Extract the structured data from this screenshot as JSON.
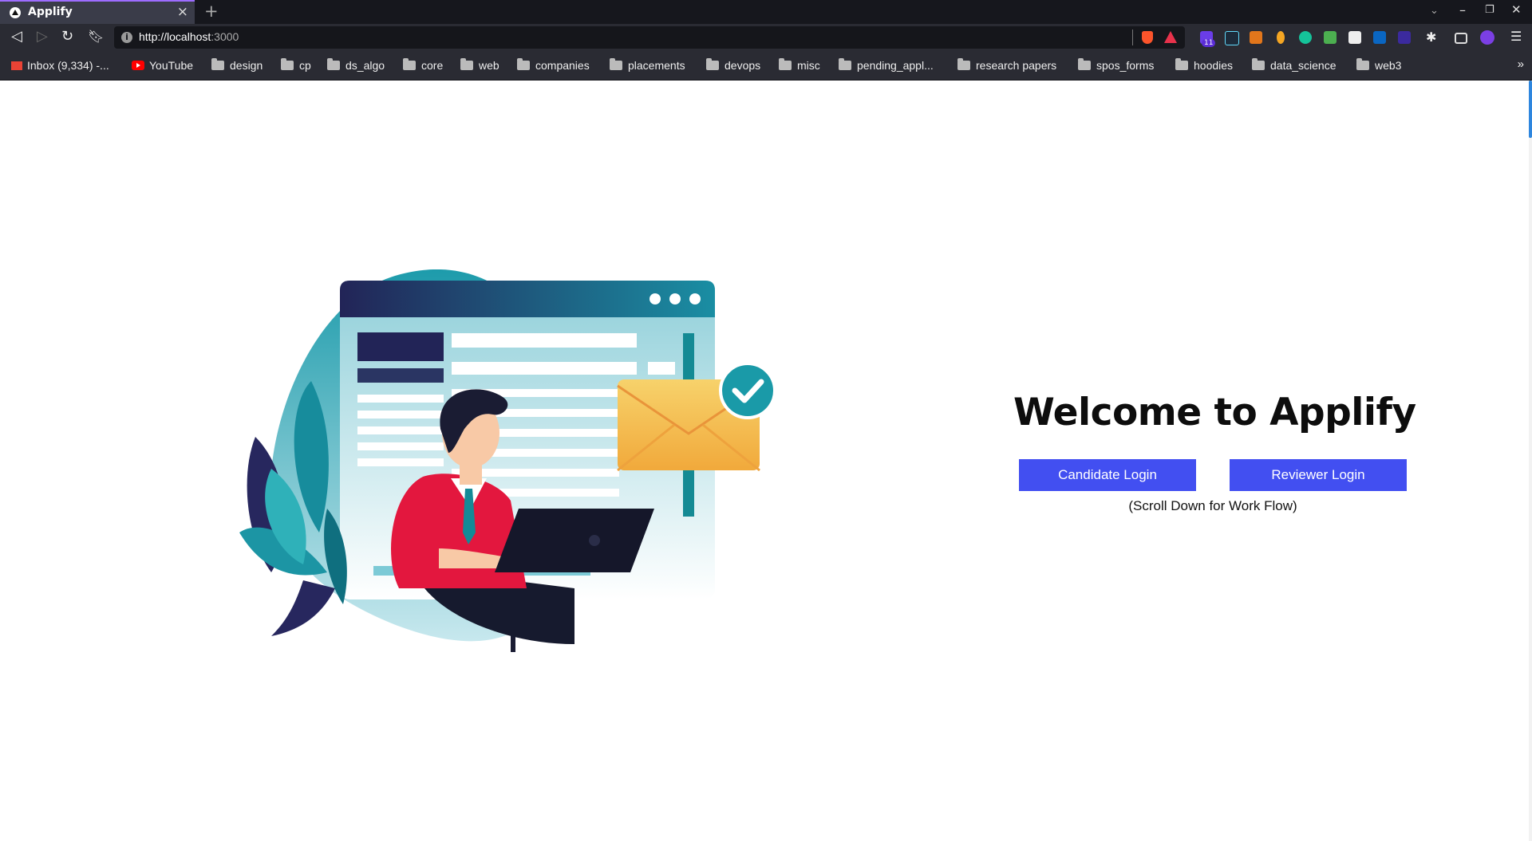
{
  "browser": {
    "tab": {
      "title": "Applify"
    },
    "url": {
      "scheme_host": "http://localhost",
      "port": ":3000"
    },
    "extension_badge": "11",
    "bookmarks": [
      {
        "label": "Inbox (9,334) -...",
        "icon": "gmail-icon"
      },
      {
        "label": "YouTube",
        "icon": "youtube-icon"
      },
      {
        "label": "design",
        "icon": "folder-icon"
      },
      {
        "label": "cp",
        "icon": "folder-icon"
      },
      {
        "label": "ds_algo",
        "icon": "folder-icon"
      },
      {
        "label": "core",
        "icon": "folder-icon"
      },
      {
        "label": "web",
        "icon": "folder-icon"
      },
      {
        "label": "companies",
        "icon": "folder-icon"
      },
      {
        "label": "placements",
        "icon": "folder-icon"
      },
      {
        "label": "devops",
        "icon": "folder-icon"
      },
      {
        "label": "misc",
        "icon": "folder-icon"
      },
      {
        "label": "pending_appl...",
        "icon": "folder-icon"
      },
      {
        "label": "research papers",
        "icon": "folder-icon"
      },
      {
        "label": "spos_forms",
        "icon": "folder-icon"
      },
      {
        "label": "hoodies",
        "icon": "folder-icon"
      },
      {
        "label": "data_science",
        "icon": "folder-icon"
      },
      {
        "label": "web3",
        "icon": "folder-icon"
      }
    ]
  },
  "page": {
    "heading": "Welcome to Applify",
    "candidate_login": "Candidate Login",
    "reviewer_login": "Reviewer Login",
    "scroll_hint": "(Scroll Down for Work Flow)",
    "colors": {
      "button": "#424ff1",
      "accent_teal": "#1a9aa8",
      "navy": "#222457"
    }
  }
}
